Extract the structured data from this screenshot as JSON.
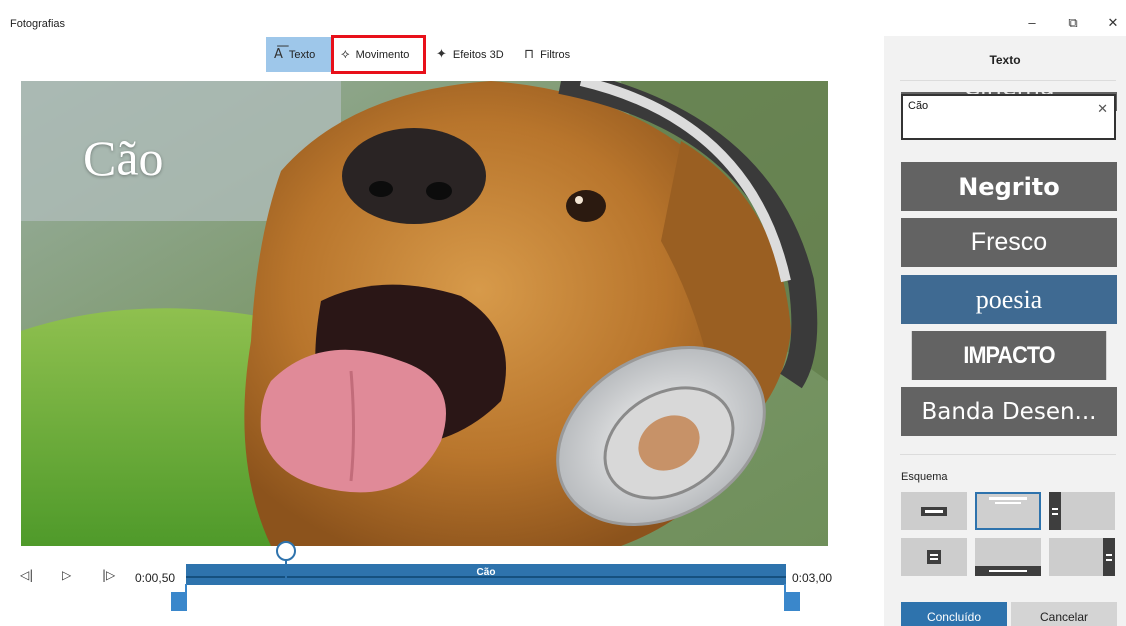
{
  "window": {
    "title": "Fotografias",
    "controls": {
      "minimize": "–",
      "restore": "⧉",
      "close": "✕"
    }
  },
  "toolbar": {
    "tabs": [
      {
        "label": "Texto",
        "icon": "text-icon",
        "glyph": "A͞"
      },
      {
        "label": "Movimento",
        "icon": "motion-icon",
        "glyph": "⟡"
      },
      {
        "label": "Efeitos 3D",
        "icon": "effects-3d-icon",
        "glyph": "✦"
      },
      {
        "label": "Filtros",
        "icon": "filter-icon",
        "glyph": "⊓"
      }
    ],
    "active_tab": "Texto",
    "highlighted_tab": "Movimento"
  },
  "preview": {
    "overlay_text": "Cão",
    "scene": "dog-with-headphones-photo"
  },
  "timeline": {
    "controls": {
      "step_back": "◁|",
      "play": "▷",
      "step_forward": "|▷"
    },
    "start_time": "0:00,50",
    "end_time": "0:03,00",
    "clip_label": "Cão",
    "playhead_progress": 0.17
  },
  "panel": {
    "title": "Texto",
    "text_input": {
      "value": "Cão",
      "clear_icon": "✕"
    },
    "styles": [
      {
        "label": "Cinema",
        "selected": false
      },
      {
        "label": "Negrito",
        "selected": false
      },
      {
        "label": "Fresco",
        "selected": false
      },
      {
        "label": "poesia",
        "selected": true
      },
      {
        "label": "IMPACTO",
        "selected": false
      },
      {
        "label": "Banda Desen...",
        "selected": false
      }
    ],
    "layout_label": "Esquema",
    "layout_selected_index": 1,
    "done_button": "Concluído",
    "cancel_button": "Cancelar"
  },
  "colors": {
    "accent": "#2e73ad",
    "active_tab": "#9ec7ea",
    "highlight_box": "#e8101a",
    "style_tile": "#636363",
    "style_selected": "#3f6a92"
  }
}
